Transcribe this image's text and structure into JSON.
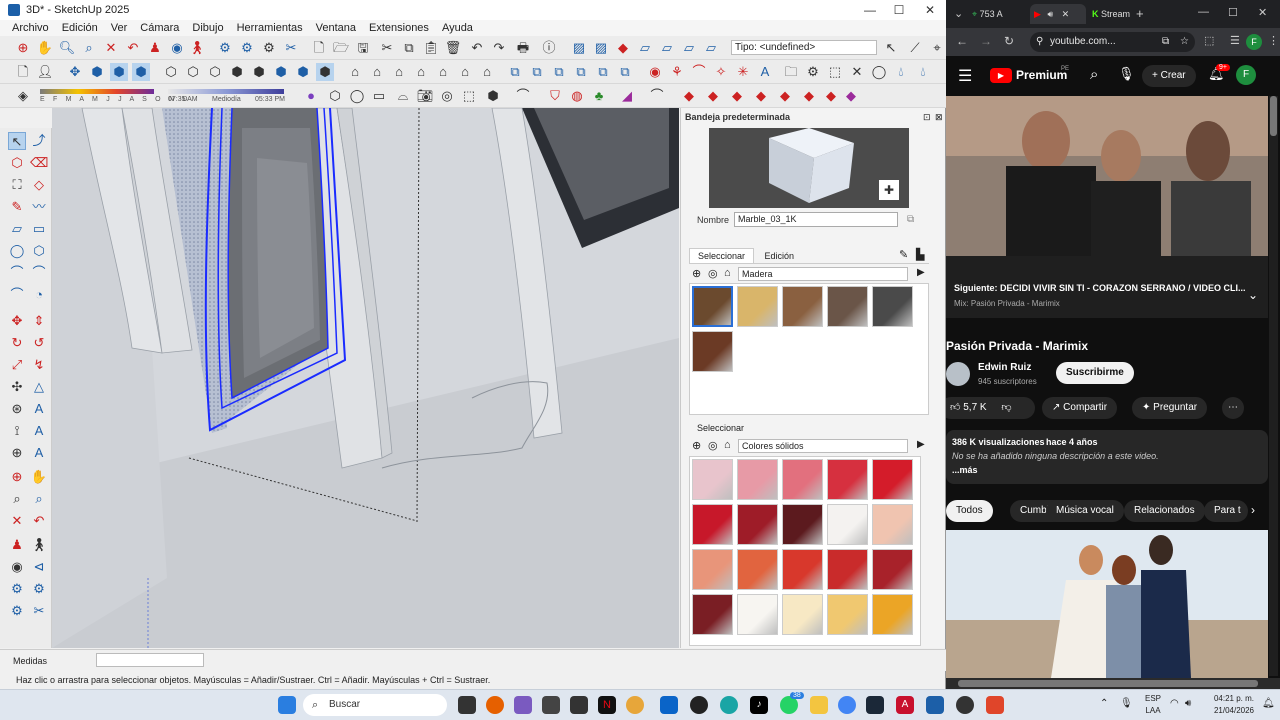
{
  "sketchup": {
    "title": "3D* - SketchUp 2025",
    "menu": [
      "Archivo",
      "Edición",
      "Ver",
      "Cámara",
      "Dibujo",
      "Herramientas",
      "Ventana",
      "Extensiones",
      "Ayuda"
    ],
    "tipo_field": "Tipo: <undefined>",
    "shadow": {
      "months": "E F M A M J J A S O N D",
      "time_start": "07:35 AM",
      "time_mid": "Mediodía",
      "time_end": "05:33 PM"
    },
    "tray": {
      "title": "Bandeja predeterminada",
      "name_label": "Nombre",
      "name_value": "Marble_03_1K",
      "tab_select": "Seleccionar",
      "tab_edit": "Edición",
      "library_1": "Madera",
      "select_2": "Seleccionar",
      "library_2": "Colores sólidos",
      "wood_swatches": [
        "#6b4a2e",
        "#d9b56a",
        "#8a6040",
        "#6a5548",
        "#4a4a4a",
        "#6b3a25"
      ],
      "color_swatches": [
        "#e8c4cc",
        "#e79aa6",
        "#e2707e",
        "#d6303f",
        "#d41c2a",
        "#c7182a",
        "#9e1c28",
        "#5c1a1e",
        "#f4f2f0",
        "#f0c4b0",
        "#e8957a",
        "#e1643f",
        "#d8382c",
        "#c92b2b",
        "#a8222a",
        "#7a1e24",
        "#f7f5f1",
        "#f7e8c4",
        "#f0c870",
        "#eba526"
      ]
    },
    "medidas_label": "Medidas",
    "status": "Haz clic o arrastra para seleccionar objetos. Mayúsculas = Añadir/Sustraer. Ctrl = Añadir. Mayúsculas + Ctrl = Sustraer."
  },
  "chrome": {
    "tab1": "753 A",
    "tab3": "Stream",
    "url": "youtube.com...",
    "yt_brand": "Premium",
    "yt_region": "PE",
    "create_label": "Crear",
    "notif_badge": "9+",
    "avatar_letter": "F",
    "up_next": "Siguiente: DECIDI VIVIR SIN TI - CORAZON SERRANO / VIDEO CLI...",
    "mix": "Mix: Pasión Privada - Marimix",
    "video_title": "Pasión Privada - Marimix",
    "channel": "Edwin Ruiz",
    "subscribers": "945 suscriptores",
    "subscribe": "Suscribirme",
    "likes": "5,7 K",
    "share": "Compartir",
    "ask": "Preguntar",
    "views": "386 K visualizaciones",
    "age": "hace 4 años",
    "desc": "No se ha añadido ninguna descripción a este video.",
    "more": "...más",
    "chips": [
      "Todos",
      "Cumbias",
      "Música vocal",
      "Relacionados",
      "Para t"
    ]
  },
  "taskbar": {
    "search": "Buscar",
    "lang_1": "ESP",
    "lang_2": "LAA",
    "time": "04:21 p. m.",
    "date": "21/04/2026",
    "whatsapp_badge": "38"
  },
  "colors": {
    "selection": "#1a2bff",
    "yt_red": "#ff0000",
    "subscribe_bg": "#f1f1f1"
  }
}
